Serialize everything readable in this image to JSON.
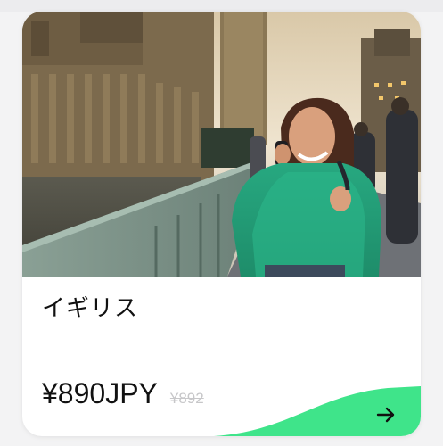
{
  "card": {
    "image_alt": "",
    "title": "イギリス",
    "price": "¥890JPY",
    "original_price": "¥892",
    "accent_color": "#3fe48a"
  },
  "icons": {
    "action": "arrow-right-icon"
  }
}
